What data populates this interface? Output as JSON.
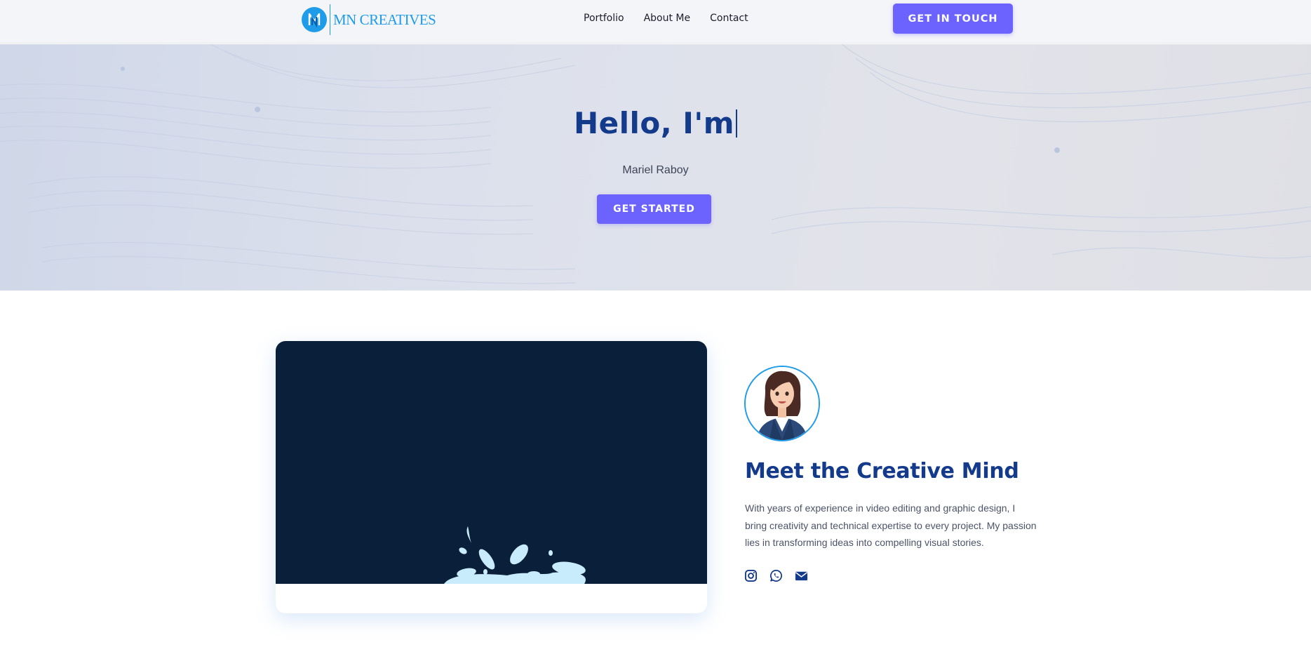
{
  "header": {
    "logo_text": "MN CREATIVES",
    "nav": [
      {
        "label": "Portfolio"
      },
      {
        "label": "About Me"
      },
      {
        "label": "Contact"
      }
    ],
    "cta_label": "GET IN TOUCH"
  },
  "hero": {
    "title": "Hello, I'm",
    "subtitle": "Mariel Raboy",
    "cta_label": "GET STARTED"
  },
  "about": {
    "title": "Meet the Creative Mind",
    "text": "With years of experience in video editing and graphic design, I bring creativity and technical expertise to every project. My passion lies in transforming ideas into compelling visual stories.",
    "socials": [
      {
        "icon": "instagram-icon"
      },
      {
        "icon": "whatsapp-icon"
      },
      {
        "icon": "envelope-icon"
      }
    ]
  },
  "colors": {
    "accent": "#6c63ff",
    "brand_blue": "#143a8c",
    "logo_blue": "#1e9be9",
    "video_bg": "#0a1f3a"
  }
}
